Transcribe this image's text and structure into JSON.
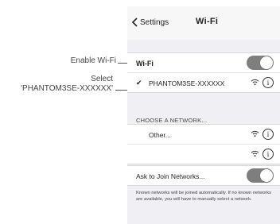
{
  "annotations": {
    "enable_wifi": "Enable Wi-Fi",
    "select_line1": "Select",
    "select_line2": "'PHANTOM3SE-XXXXXX'"
  },
  "navbar": {
    "back_label": "Settings",
    "title": "Wi-Fi"
  },
  "wifi_section": {
    "toggle_label": "Wi-Fi",
    "toggle_on": true,
    "connected_network": "PHANTOM3SE-XXXXXX"
  },
  "network_section": {
    "header": "CHOOSE A NETWORK...",
    "other_label": "Other..."
  },
  "ask_section": {
    "label": "Ask to Join Networks...",
    "toggle_on": true,
    "footnote": "Known networks will be joined automatically. If no known networks are available, you will have to manually select a network."
  },
  "colors": {
    "toggle_on": "#7e7e7e",
    "group_bg": "#efeff4"
  },
  "icons": [
    "chevron-left-icon",
    "checkmark-icon",
    "wifi-icon",
    "info-icon"
  ]
}
